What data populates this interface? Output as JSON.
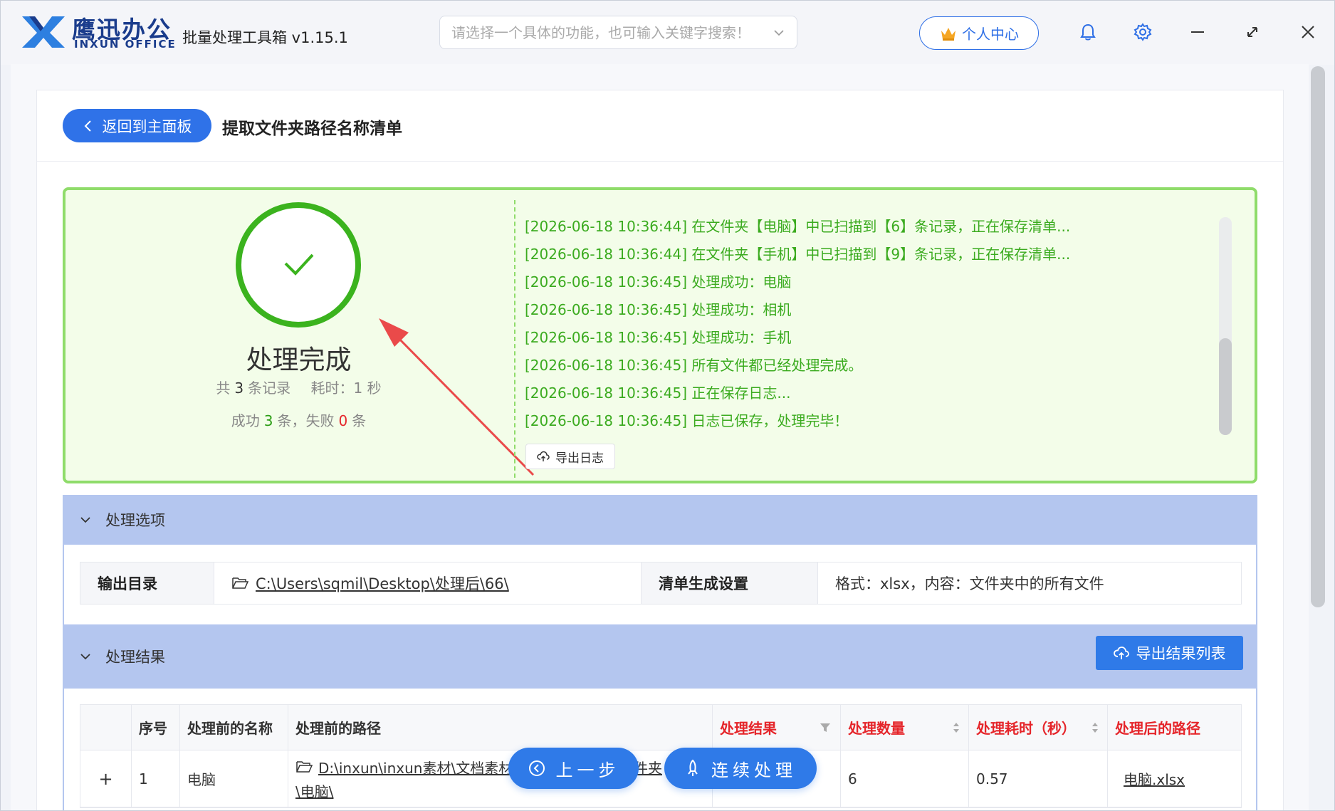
{
  "app": {
    "brand_cn": "鹰迅办公",
    "brand_en": "INXUN OFFICE",
    "title": "批量处理工具箱 v1.15.1",
    "search_placeholder": "请选择一个具体的功能，也可输入关键字搜索！",
    "user_center": "个人中心"
  },
  "page": {
    "back_label": "返回到主面板",
    "title": "提取文件夹路径名称清单"
  },
  "status": {
    "done_text": "处理完成",
    "total_prefix": "共",
    "total_count": "3",
    "total_suffix": "条记录",
    "time_label": "耗时：1 秒",
    "success_prefix": "成功",
    "success_count": "3",
    "success_suffix": "条，失败",
    "fail_count": "0",
    "fail_suffix": "条",
    "accent_green": "#3bab1f",
    "accent_red": "#e5252a"
  },
  "log": {
    "lines": [
      "[2026-06-18 10:36:44] 在文件夹【电脑】中已扫描到【6】条记录，正在保存清单...",
      "[2026-06-18 10:36:44] 在文件夹【手机】中已扫描到【9】条记录，正在保存清单...",
      "[2026-06-18 10:36:45] 处理成功：电脑",
      "[2026-06-18 10:36:45] 处理成功：相机",
      "[2026-06-18 10:36:45] 处理成功：手机",
      "[2026-06-18 10:36:45] 所有文件都已经处理完成。",
      "[2026-06-18 10:36:45] 正在保存日志...",
      "[2026-06-18 10:36:45] 日志已保存，处理完毕！"
    ],
    "export_label": "导出日志"
  },
  "options": {
    "section_title": "处理选项",
    "output_dir_label": "输出目录",
    "output_dir_value": "C:\\Users\\sqmil\\Desktop\\处理后\\66\\",
    "list_setting_label": "清单生成设置",
    "list_setting_value": "格式：xlsx，内容：文件夹中的所有文件"
  },
  "results": {
    "section_title": "处理结果",
    "export_label": "导出结果列表",
    "columns": [
      "",
      "序号",
      "处理前的名称",
      "处理前的路径",
      "处理结果",
      "处理数量",
      "处理耗时（秒）",
      "处理后的路径"
    ],
    "rows": [
      {
        "expand": "+",
        "index": "1",
        "name": "电脑",
        "path_line1": "D:\\inxun\\inxun素材\\文档素材",
        "path_line1_tail": "件夹",
        "path_line2": "\\电脑\\",
        "result": "",
        "count": "6",
        "time": "0.57",
        "out_path": "电脑.xlsx"
      }
    ]
  },
  "footer": {
    "prev_label": "上一步",
    "continue_label": "连续处理"
  }
}
